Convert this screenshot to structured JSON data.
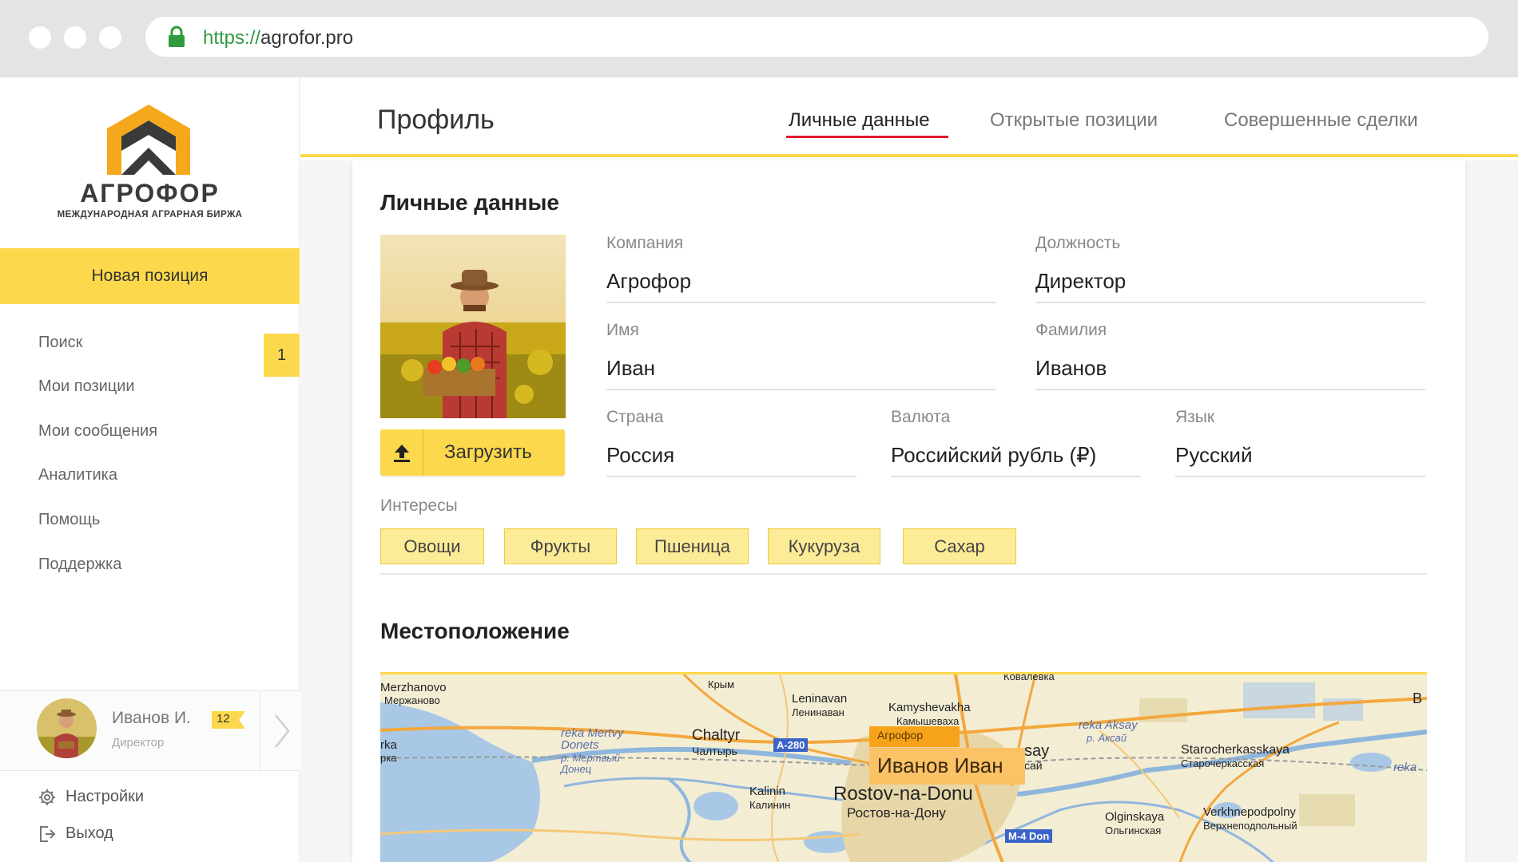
{
  "browser": {
    "url_scheme": "https://",
    "url_host": "agrofor.pro"
  },
  "brand": {
    "name": "АГРОФОР",
    "tagline": "МЕЖДУНАРОДНАЯ АГРАРНАЯ БИРЖА",
    "accent_color": "#fcd94c"
  },
  "sidebar": {
    "new_position_label": "Новая позиция",
    "items": [
      {
        "label": "Поиск"
      },
      {
        "label": "Мои позиции"
      },
      {
        "label": "Мои сообщения",
        "badge": "1"
      },
      {
        "label": "Аналитика"
      },
      {
        "label": "Помощь"
      },
      {
        "label": "Поддержка"
      }
    ],
    "user": {
      "name": "Иванов И.",
      "role": "Директор",
      "badge": "12"
    },
    "settings_label": "Настройки",
    "logout_label": "Выход"
  },
  "header": {
    "title": "Профиль",
    "tabs": [
      {
        "label": "Личные данные",
        "active": true
      },
      {
        "label": "Открытые позиции",
        "active": false
      },
      {
        "label": "Совершенные сделки",
        "active": false
      }
    ]
  },
  "personal": {
    "section_title": "Личные данные",
    "upload_label": "Загрузить",
    "fields": {
      "company": {
        "label": "Компания",
        "value": "Агрофор"
      },
      "position": {
        "label": "Должность",
        "value": "Директор"
      },
      "first_name": {
        "label": "Имя",
        "value": "Иван"
      },
      "last_name": {
        "label": "Фамилия",
        "value": "Иванов"
      },
      "country": {
        "label": "Страна",
        "value": "Россия"
      },
      "currency": {
        "label": "Валюта",
        "value": "Российский рубль (₽)"
      },
      "language": {
        "label": "Язык",
        "value": "Русский"
      }
    },
    "interests_label": "Интересы",
    "interests": [
      "Овощи",
      "Фрукты",
      "Пшеница",
      "Кукуруза",
      "Сахар"
    ]
  },
  "location": {
    "section_title": "Местоположение",
    "map": {
      "marker_company": "Агрофор",
      "marker_name": "Иванов Иван",
      "labels": {
        "merzhanovo_en": "Merzhanovo",
        "merzhanovo_ru": "Мержаново",
        "krym_ru": "Крым",
        "leninavan_en": "Leninavan",
        "leninavan_ru": "Ленинаван",
        "kamyshevakha_en": "Kamyshevakha",
        "kamyshevakha_ru": "Камышеваха",
        "kovalevka_ru": "Ковалевка",
        "chaltyr_en": "Chaltyr",
        "chaltyr_ru": "Чалтырь",
        "mertvy_en": "reka Mertvy Donets",
        "mertvy_ru": "р. Мертвый Донец",
        "aksay_en": "reka Aksay",
        "aksay_ru": "р. Аксай",
        "aksay_town_en": "say",
        "aksay_town_ru": "сай",
        "starocherkasskaya_en": "Starocherkasskaya",
        "starocherkasskaya_ru": "Старочеркасская",
        "kalinin_en": "Kalinin",
        "kalinin_ru": "Калинин",
        "rostov_en": "Rostov-na-Donu",
        "rostov_ru": "Ростов-на-Дону",
        "olginskaya_en": "Olginskaya",
        "olginskaya_ru": "Ольгинская",
        "verkhnepodpolny_en": "Verkhnepodpolny",
        "verkhnepodpolny_ru": "Верхнеподпольный",
        "edge_left_en": "rka",
        "edge_left_ru": "рка",
        "edge_right_en": "reka",
        "edge_right_b": "B",
        "road_a280": "A-280",
        "road_m4": "M-4 Don"
      }
    }
  }
}
